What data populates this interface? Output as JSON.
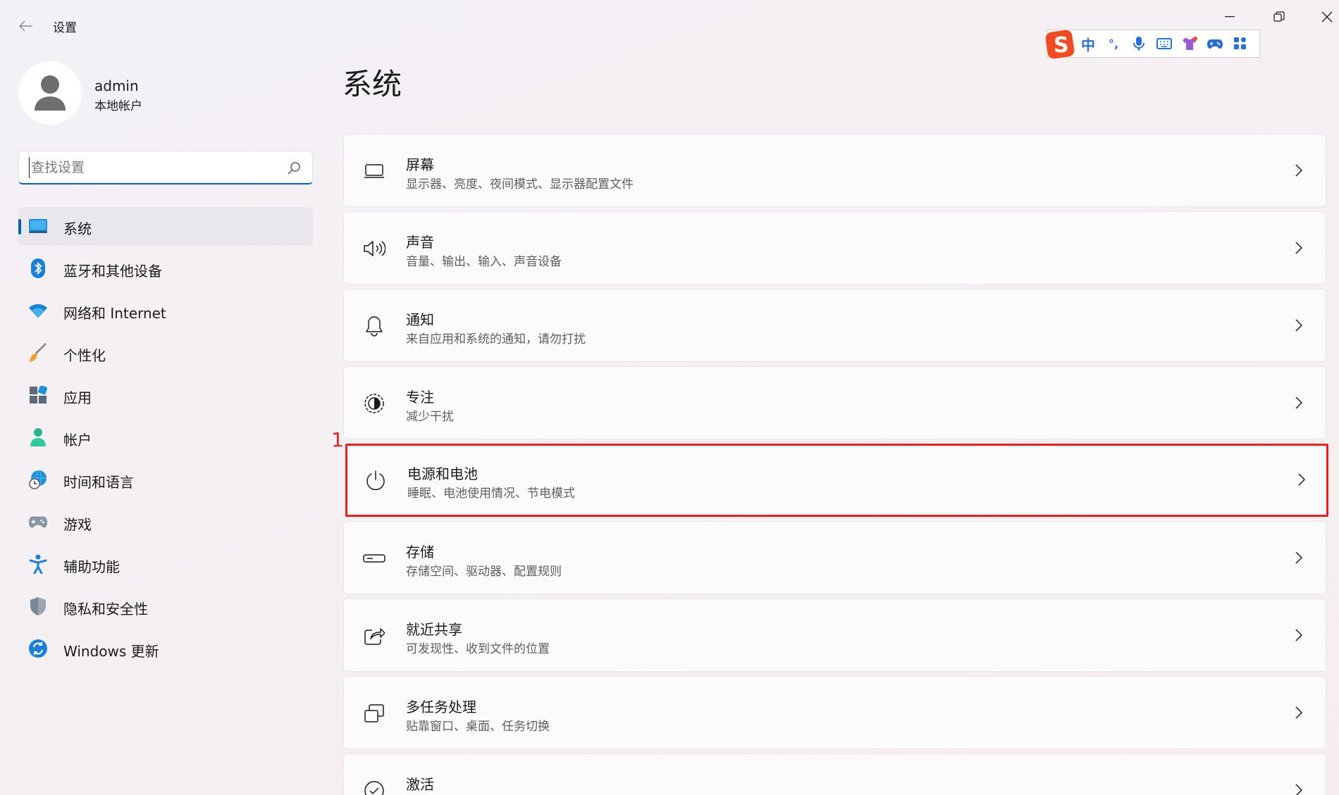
{
  "window": {
    "title": "设置",
    "controls": {
      "minimize": "minimize",
      "maximize": "maximize",
      "close": "close"
    }
  },
  "ime_toolbar": {
    "items": [
      "中",
      "°,",
      "mic-icon",
      "keyboard-icon",
      "shirt-icon",
      "gamepad-icon",
      "grid-icon"
    ]
  },
  "profile": {
    "name": "admin",
    "account_type": "本地帐户"
  },
  "search": {
    "placeholder": "查找设置",
    "value": ""
  },
  "sidebar": {
    "accent": "#0a5fb7",
    "items": [
      {
        "label": "系统",
        "icon": "monitor-icon",
        "selected": true
      },
      {
        "label": "蓝牙和其他设备",
        "icon": "bluetooth-icon"
      },
      {
        "label": "网络和 Internet",
        "icon": "wifi-icon"
      },
      {
        "label": "个性化",
        "icon": "brush-icon"
      },
      {
        "label": "应用",
        "icon": "apps-icon"
      },
      {
        "label": "帐户",
        "icon": "person-icon"
      },
      {
        "label": "时间和语言",
        "icon": "globe-clock-icon"
      },
      {
        "label": "游戏",
        "icon": "gamepad-icon"
      },
      {
        "label": "辅助功能",
        "icon": "accessibility-icon"
      },
      {
        "label": "隐私和安全性",
        "icon": "shield-icon"
      },
      {
        "label": "Windows 更新",
        "icon": "update-icon"
      }
    ]
  },
  "main": {
    "title": "系统",
    "annotation": "1",
    "annotation_color": "#e5201e",
    "cards": [
      {
        "title": "屏幕",
        "subtitle": "显示器、亮度、夜间模式、显示器配置文件",
        "icon": "laptop-icon"
      },
      {
        "title": "声音",
        "subtitle": "音量、输出、输入、声音设备",
        "icon": "speaker-icon"
      },
      {
        "title": "通知",
        "subtitle": "来自应用和系统的通知，请勿打扰",
        "icon": "bell-icon"
      },
      {
        "title": "专注",
        "subtitle": "减少干扰",
        "icon": "focus-icon"
      },
      {
        "title": "电源和电池",
        "subtitle": "睡眠、电池使用情况、节电模式",
        "icon": "power-icon",
        "highlighted": true
      },
      {
        "title": "存储",
        "subtitle": "存储空间、驱动器、配置规则",
        "icon": "storage-icon"
      },
      {
        "title": "就近共享",
        "subtitle": "可发现性、收到文件的位置",
        "icon": "share-icon"
      },
      {
        "title": "多任务处理",
        "subtitle": "贴靠窗口、桌面、任务切换",
        "icon": "multitask-icon"
      },
      {
        "title": "激活",
        "subtitle": "",
        "icon": "check-circle-icon"
      }
    ]
  }
}
